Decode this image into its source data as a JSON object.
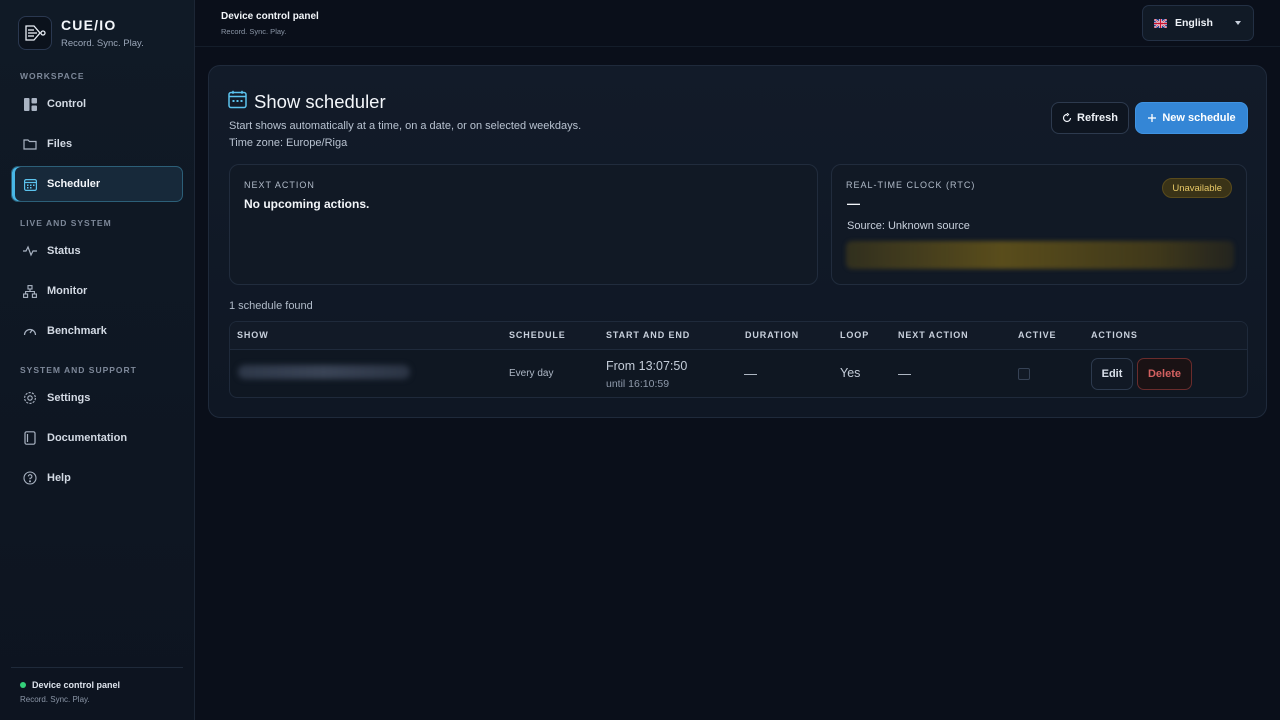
{
  "brand": {
    "name": "CUE/IO",
    "tagline": "Record. Sync. Play."
  },
  "sidebar": {
    "sections": [
      {
        "label": "WORKSPACE"
      },
      {
        "label": "LIVE AND SYSTEM"
      },
      {
        "label": "SYSTEM AND SUPPORT"
      }
    ],
    "items": [
      {
        "label": "Control",
        "icon": "dashboard-icon"
      },
      {
        "label": "Files",
        "icon": "folder-icon"
      },
      {
        "label": "Scheduler",
        "icon": "calendar-icon",
        "active": true
      },
      {
        "label": "Status",
        "icon": "activity-icon"
      },
      {
        "label": "Monitor",
        "icon": "network-icon"
      },
      {
        "label": "Benchmark",
        "icon": "gauge-icon"
      },
      {
        "label": "Settings",
        "icon": "gear-icon"
      },
      {
        "label": "Documentation",
        "icon": "document-icon"
      },
      {
        "label": "Help",
        "icon": "help-icon"
      }
    ],
    "footer": {
      "title": "Device control panel",
      "tagline": "Record. Sync. Play.",
      "status_color": "#34d17a"
    }
  },
  "topbar": {
    "title": "Device control panel",
    "subtitle": "Record. Sync. Play.",
    "language": {
      "selected": "English",
      "flag_icon": "uk-flag-icon"
    }
  },
  "scheduler": {
    "title": "Show scheduler",
    "description": "Start shows automatically at a time, on a date, or on selected weekdays.",
    "timezone": "Time zone: Europe/Riga",
    "refresh_label": "Refresh",
    "new_label": "New schedule",
    "next_action": {
      "label": "NEXT ACTION",
      "value": "No upcoming actions."
    },
    "rtc": {
      "label": "REAL-TIME CLOCK (RTC)",
      "value": "—",
      "source": "Source: Unknown source",
      "badge": "Unavailable"
    },
    "count_text": "1 schedule found",
    "table": {
      "columns": [
        "SHOW",
        "SCHEDULE",
        "START AND END",
        "DURATION",
        "LOOP",
        "NEXT ACTION",
        "ACTIVE",
        "ACTIONS"
      ],
      "rows": [
        {
          "schedule": "Every day",
          "start": "From 13:07:50",
          "end": "until 16:10:59",
          "duration": "—",
          "loop": "Yes",
          "next_action": "—",
          "active": false,
          "edit_label": "Edit",
          "delete_label": "Delete"
        }
      ]
    }
  },
  "colors": {
    "accent": "#3486d6",
    "active_nav": "#48b7e6",
    "badge_warning": "#e7c867",
    "danger": "#d46060"
  }
}
